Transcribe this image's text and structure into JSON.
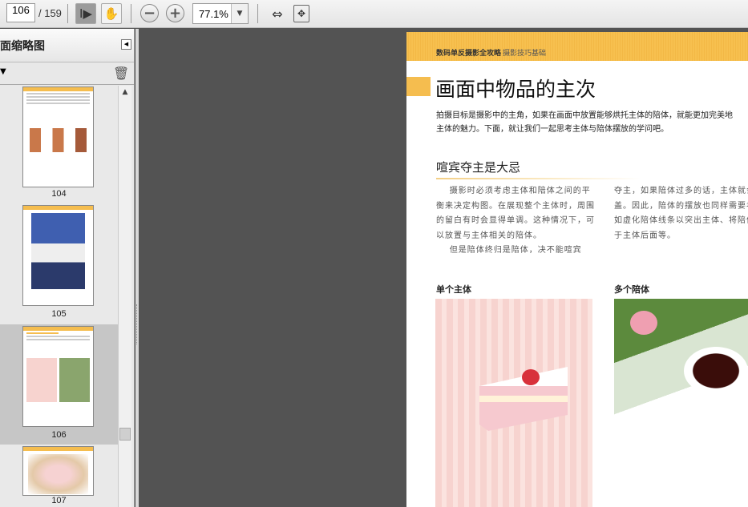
{
  "toolbar": {
    "page_current": "106",
    "page_total": "/ 159",
    "zoom": "77.1%",
    "icons": [
      "select-tool-icon",
      "hand-tool-icon",
      "zoom-out-icon",
      "zoom-in-icon",
      "fit-width-icon",
      "fit-page-icon"
    ]
  },
  "sidebar": {
    "title": "面缩略图",
    "thumbnails": [
      {
        "label": "104"
      },
      {
        "label": "105"
      },
      {
        "label": "106"
      },
      {
        "label": "107"
      }
    ]
  },
  "document": {
    "header": "数码单反摄影全攻略",
    "header_sub": "摄影技巧基础",
    "title": "画面中物品的主次",
    "intro": "拍摄目标是摄影中的主角，如果在画面中放置能够烘托主体的陪体，就能更加完美地\n主体的魅力。下面，就让我们一起思考主体与陪体摆放的学问吧。",
    "section_title": "喧宾夺主是大忌",
    "col1": "    摄影时必须考虑主体和陪体之间的平\n衡来决定构图。在展现整个主体时，周围\n的留白有时会显得单调。这种情况下，可\n以放置与主体相关的陪体。\n    但是陪体终归是陪体，决不能喧宾",
    "col2": "夺主，如果陪体过多的话，主体就会\n盖。因此，陪体的摆放也同样需要考\n如虚化陪体线条以突出主体、将陪体\n于主体后面等。",
    "caption1": "单个主体",
    "caption2": "多个陪体"
  }
}
